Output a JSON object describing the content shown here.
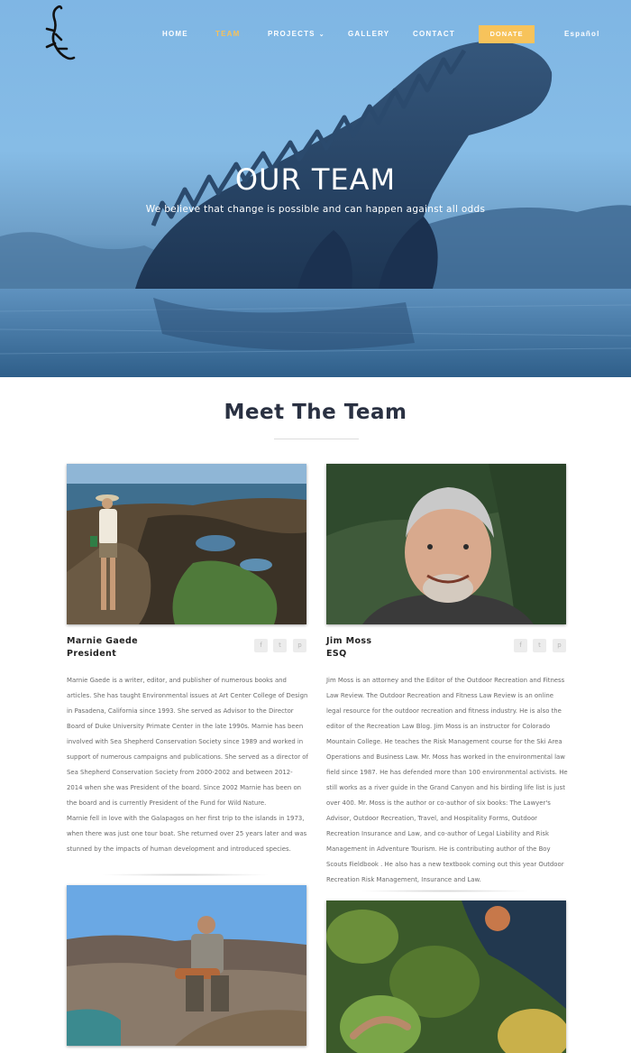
{
  "nav": {
    "items": [
      {
        "label": "HOME",
        "active": false
      },
      {
        "label": "TEAM",
        "active": true
      },
      {
        "label": "PROJECTS",
        "active": false,
        "has_dropdown": true
      },
      {
        "label": "GALLERY",
        "active": false
      },
      {
        "label": "CONTACT",
        "active": false
      }
    ],
    "donate_label": "DONATE",
    "language_label": "Español"
  },
  "hero": {
    "title": "OUR TEAM",
    "subtitle": "We believe that change is possible and can happen against all odds"
  },
  "section": {
    "title": "Meet The Team"
  },
  "team": [
    {
      "name": "Marnie Gaede",
      "role": "President",
      "bio": [
        "Marnie Gaede is a writer, editor, and publisher of numerous books and articles. She has taught Environmental issues at Art Center College of Design in Pasadena, California since 1993. She served as Advisor to the Director Board of Duke University Primate Center in the late 1990s. Marnie has been involved with Sea Shepherd Conservation Society since 1989 and worked in support of numerous campaigns and publications. She served as a director of Sea Shepherd Conservation Society from 2000-2002 and between 2012- 2014 when she was President of the board. Since 2002 Marnie has been on the board and is currently President of the Fund for Wild Nature.",
        "Marnie fell in love with the Galapagos on her first trip to the islands in 1973, when there was just one tour boat. She returned over 25 years later and was stunned by the impacts of human development and introduced species."
      ]
    },
    {
      "name": "Jim Moss",
      "role": "ESQ",
      "bio": [
        "Jim Moss is an attorney and the Editor of the Outdoor Recreation and Fitness Law Review. The Outdoor Recreation and Fitness Law Review is an online legal resource for the outdoor recreation and fitness industry. He is also the editor of the Recreation Law Blog. Jim Moss is an instructor for Colorado Mountain College. He teaches the Risk Management course for the Ski Area Operations and Business Law. Mr. Moss has worked in the environmental law field since 1987. He has defended more than 100 environmental activists. He still works as a river guide in the Grand Canyon and his birding life list is just over 400. Mr. Moss is the author or co-author of six books: The Lawyer's Advisor, Outdoor Recreation, Travel, and Hospitality Forms, Outdoor Recreation Insurance and Law, and co-author of Legal Liability and Risk Management in Adventure Tourism. He is contributing author of the Boy Scouts Fieldbook . He also has a new textbook coming out this year Outdoor Recreation Risk Management, Insurance and Law."
      ]
    }
  ],
  "social_icons": [
    "facebook-icon",
    "twitter-icon",
    "pinterest-icon"
  ],
  "social_glyphs": [
    "f",
    "t",
    "p"
  ],
  "colors": {
    "accent": "#f7c35b",
    "heading": "#2a3142",
    "hero_sky": "#7fb6e4"
  }
}
